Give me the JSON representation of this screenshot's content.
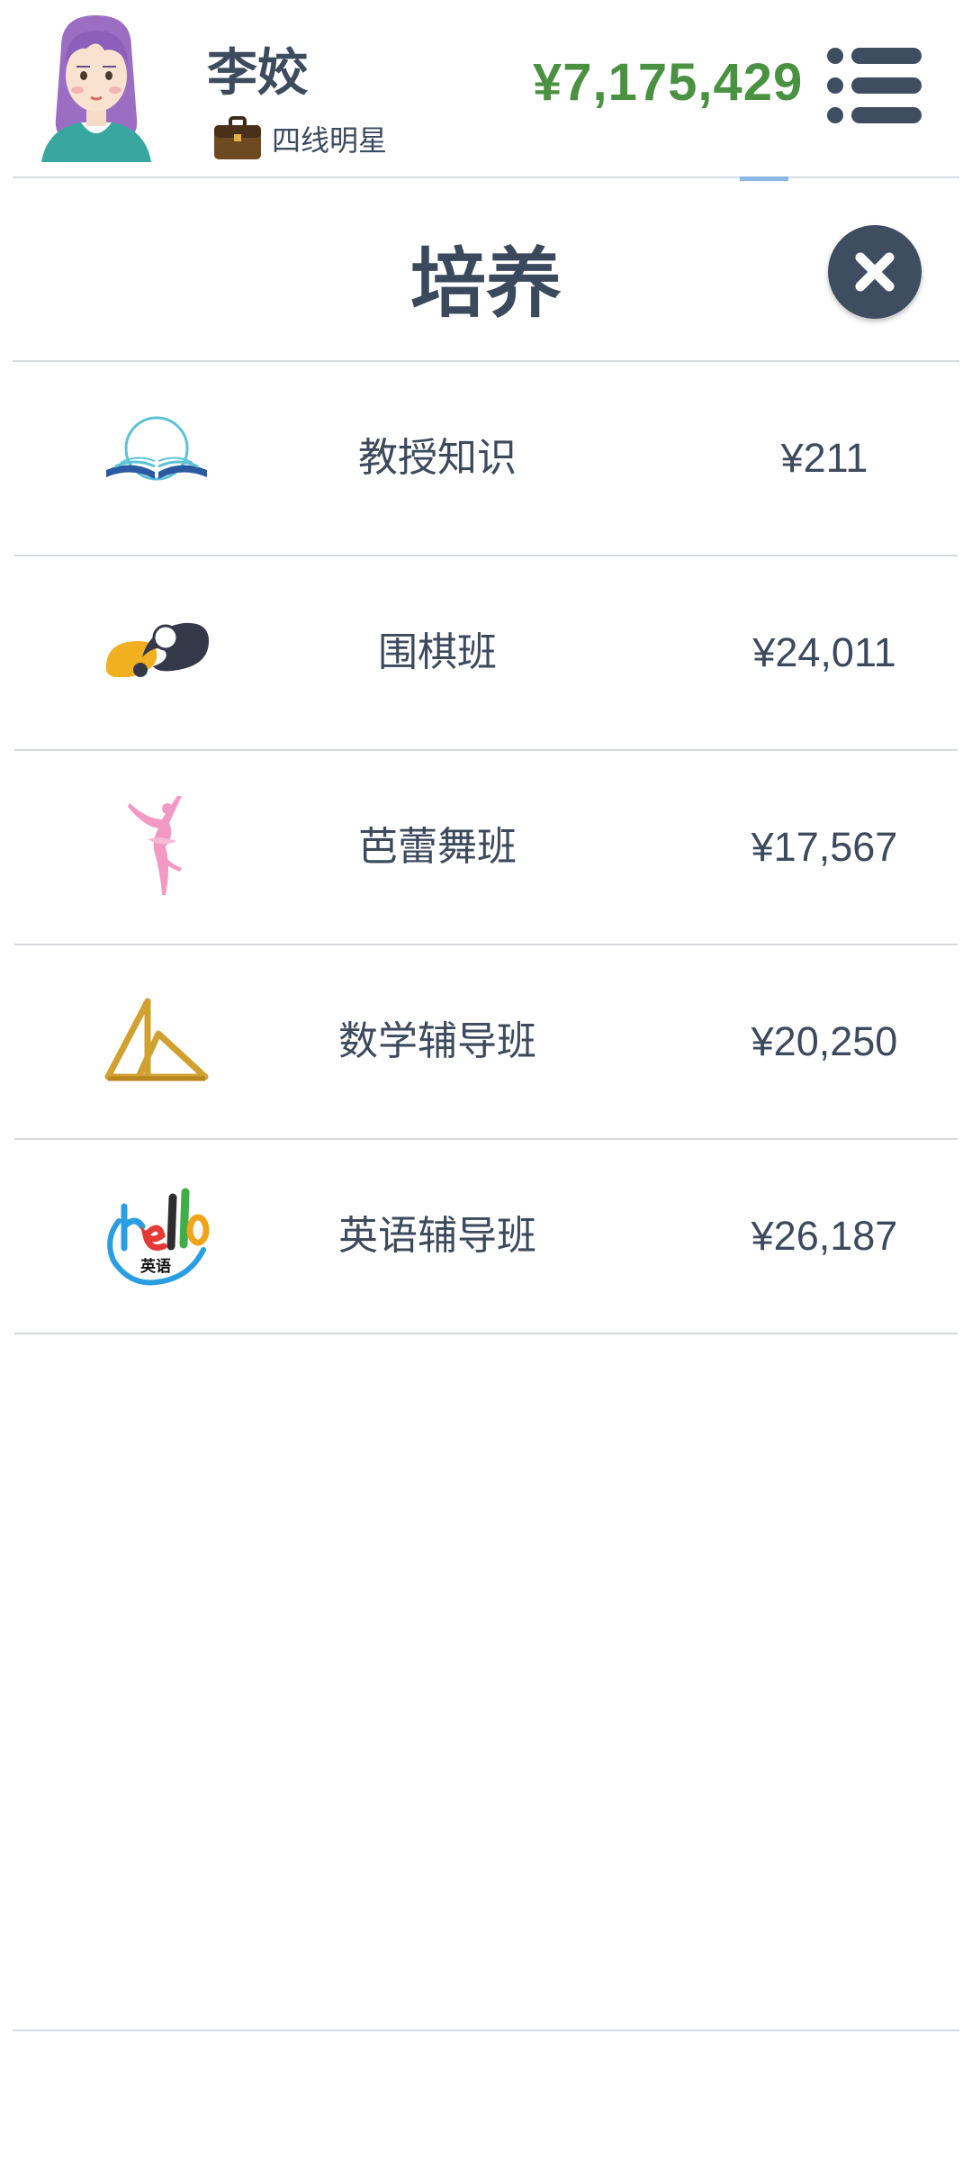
{
  "header": {
    "user_name": "李姣",
    "rank_label": "四线明星",
    "balance": "¥7,175,429",
    "avatar_icon": "girl-avatar-icon",
    "rank_icon": "briefcase-icon",
    "menu_icon": "menu-list-icon"
  },
  "panel": {
    "title": "培养",
    "close_icon": "close-icon"
  },
  "training_items": [
    {
      "icon": "book-icon",
      "name": "教授知识",
      "price": "¥211"
    },
    {
      "icon": "go-stones-icon",
      "name": "围棋班",
      "price": "¥24,011"
    },
    {
      "icon": "ballerina-icon",
      "name": "芭蕾舞班",
      "price": "¥17,567"
    },
    {
      "icon": "set-square-icon",
      "name": "数学辅导班",
      "price": "¥20,250"
    },
    {
      "icon": "hello-english-icon",
      "name": "英语辅导班",
      "price": "¥26,187",
      "logo_text": "Hello 英语"
    }
  ],
  "colors": {
    "balance_green": "#4b9142",
    "text_dark": "#3c4a5c",
    "close_button": "#3f4d61",
    "divider": "#d6d9dc"
  }
}
